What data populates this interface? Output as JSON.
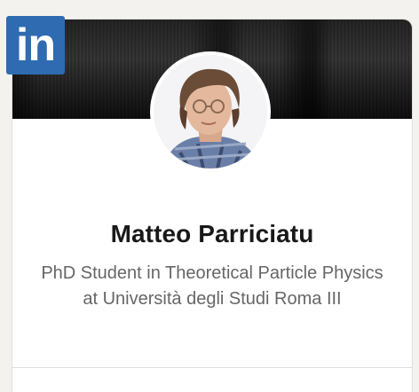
{
  "brand": {
    "logo_text": "in",
    "logo_color": "#2e6bb1"
  },
  "profile": {
    "name": "Matteo Parriciatu",
    "headline": "PhD Student in Theoretical Particle Physics at Università degli Studi Roma III"
  },
  "colors": {
    "name": "#191919",
    "headline": "#666666",
    "background": "#f3f2ef"
  }
}
